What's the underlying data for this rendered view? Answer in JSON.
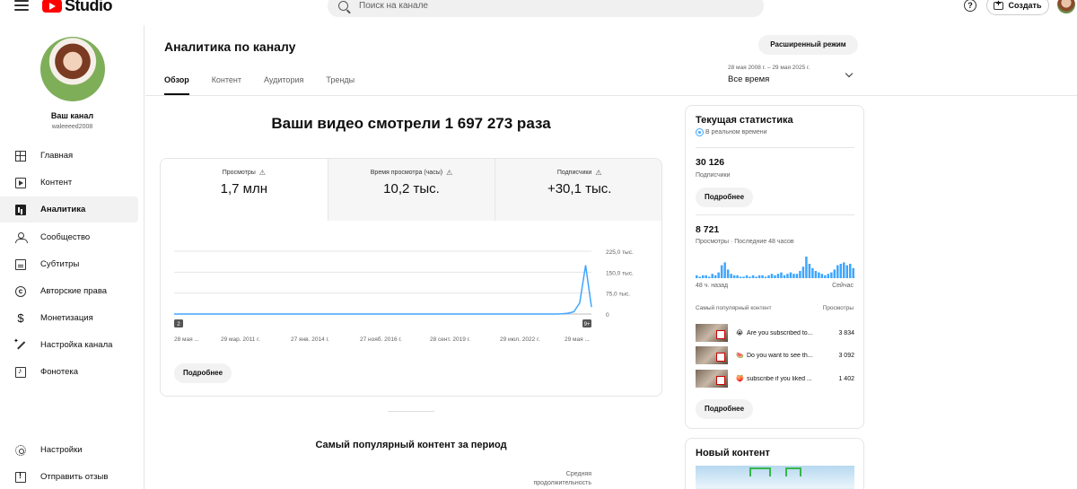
{
  "topbar": {
    "logo_text": "Studio",
    "search_placeholder": "Поиск на канале",
    "create_label": "Создать"
  },
  "sidebar": {
    "channel_name": "Ваш канал",
    "channel_handle": "waleeeed2008",
    "items": [
      {
        "label": "Главная",
        "icon": "dashboard-icon"
      },
      {
        "label": "Контент",
        "icon": "content-icon"
      },
      {
        "label": "Аналитика",
        "icon": "analytics-icon",
        "active": true
      },
      {
        "label": "Сообщество",
        "icon": "community-icon"
      },
      {
        "label": "Субтитры",
        "icon": "subtitles-icon"
      },
      {
        "label": "Авторские права",
        "icon": "copyright-icon"
      },
      {
        "label": "Монетизация",
        "icon": "monetization-icon"
      },
      {
        "label": "Настройка канала",
        "icon": "customization-icon"
      },
      {
        "label": "Фонотека",
        "icon": "audio-library-icon"
      }
    ],
    "bottom_items": [
      {
        "label": "Настройки",
        "icon": "settings-icon"
      },
      {
        "label": "Отправить отзыв",
        "icon": "feedback-icon"
      }
    ]
  },
  "header": {
    "title": "Аналитика по каналу",
    "advanced_mode_label": "Расширенный режим",
    "date_range": "28 мая 2008 г. – 29 мая 2025 г.",
    "date_preset": "Все время",
    "tabs": [
      {
        "label": "Обзор",
        "active": true
      },
      {
        "label": "Контент"
      },
      {
        "label": "Аудитория"
      },
      {
        "label": "Тренды"
      }
    ]
  },
  "summary": {
    "headline": "Ваши видео смотрели 1 697 273 раза",
    "metrics": [
      {
        "label": "Просмотры",
        "value": "1,7 млн",
        "selected": true
      },
      {
        "label": "Время просмотра (часы)",
        "value": "10,2 тыс."
      },
      {
        "label": "Подписчики",
        "value": "+30,1 тыс."
      }
    ],
    "more_label": "Подробнее"
  },
  "chart_data": {
    "type": "line",
    "title": "",
    "xlabel": "",
    "ylabel": "",
    "x_ticks": [
      "28 мая ...",
      "29 мар. 2011 г.",
      "27 янв. 2014 г.",
      "27 нояб. 2016 г.",
      "28 сент. 2019 г.",
      "29 июл. 2022 г.",
      "29 мая ..."
    ],
    "y_ticks": [
      "225,0 тыс.",
      "150,0 тыс.",
      "75,0 тыс.",
      "0"
    ],
    "ylim": [
      0,
      225000
    ],
    "series": [
      {
        "values": [
          0,
          0,
          0,
          0,
          0,
          0,
          0,
          0,
          0,
          0,
          0,
          0,
          0,
          0,
          0,
          0,
          0,
          0,
          0,
          0,
          0,
          0,
          0,
          0,
          0,
          0,
          0,
          0,
          0,
          0,
          0,
          0,
          0,
          0,
          0,
          0,
          0,
          0,
          0,
          0,
          0,
          0,
          0,
          0,
          0,
          0,
          0,
          0,
          0,
          0,
          0,
          0,
          0,
          0,
          0,
          0,
          0,
          0,
          0,
          0,
          0,
          0,
          0,
          0,
          0,
          0,
          1000,
          3000,
          8000,
          40000,
          175000,
          25000
        ],
        "color": "#3ea6ff"
      }
    ],
    "markers": [
      {
        "label": "2",
        "position": "start"
      },
      {
        "label": "9+",
        "position": "end"
      }
    ],
    "grid": true
  },
  "realtime": {
    "title": "Текущая статистика",
    "live_label": "В реальном времени",
    "subscribers_value": "30 126",
    "subscribers_label": "Подписчики",
    "more_label": "Подробнее",
    "views_value": "8 721",
    "views_label": "Просмотры · Последние 48 часов",
    "bars_start_label": "48 ч. назад",
    "bars_end_label": "Сейчас",
    "bars": [
      2,
      1,
      2,
      2,
      1,
      3,
      2,
      4,
      9,
      11,
      6,
      3,
      2,
      2,
      1,
      1,
      2,
      1,
      2,
      1,
      2,
      2,
      1,
      2,
      3,
      2,
      3,
      4,
      2,
      3,
      4,
      3,
      3,
      5,
      8,
      15,
      10,
      7,
      5,
      4,
      3,
      2,
      3,
      4,
      6,
      9,
      10,
      11,
      9,
      10,
      7
    ],
    "top_header": "Самый популярный контент",
    "top_header_right": "Просмотры",
    "top_items": [
      {
        "emoji": "😭",
        "title": "Are you subscribed to...",
        "views": "3 834"
      },
      {
        "emoji": "🍉",
        "title": "Do you want to see th...",
        "views": "3 092"
      },
      {
        "emoji": "🍑",
        "title": "subscribe if you liked ...",
        "views": "1 402"
      }
    ],
    "bottom_more_label": "Подробнее"
  },
  "new_content": {
    "title": "Новый контент"
  },
  "popular": {
    "title": "Самый популярный контент за период",
    "avg_duration_line1": "Средняя",
    "avg_duration_line2": "продолжительность"
  },
  "colors": {
    "accent": "#3ea6ff",
    "brand": "#ff0000"
  }
}
